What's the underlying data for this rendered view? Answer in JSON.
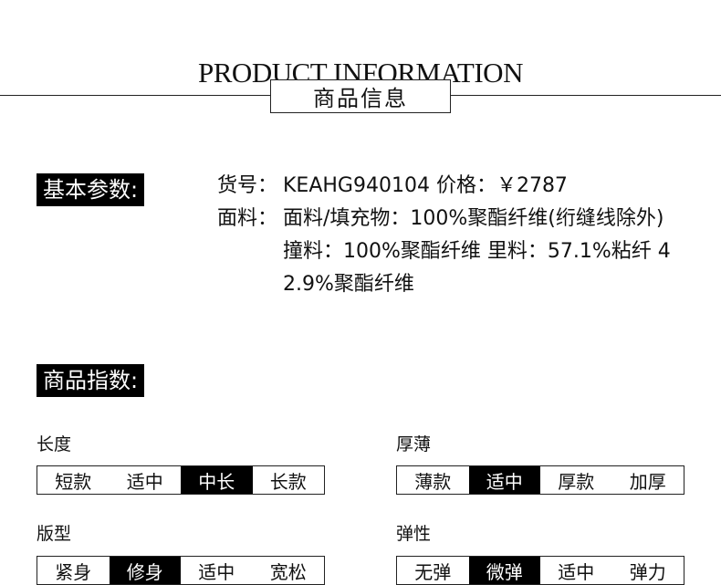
{
  "header": {
    "title_en": "PRODUCT INFORMATION",
    "title_cn": "商品信息"
  },
  "basic": {
    "label": "基本参数:",
    "rows": [
      {
        "key": "货号：",
        "value": "KEAHG940104  价格：￥2787"
      },
      {
        "key": "面料：",
        "value": "面料/填充物：100%聚酯纤维(绗缝线除外) 撞料：100%聚酯纤维 里料：57.1%粘纤 42.9%聚酯纤维"
      }
    ]
  },
  "index": {
    "label": "商品指数:",
    "groups": [
      {
        "title": "长度",
        "options": [
          "短款",
          "适中",
          "中长",
          "长款"
        ],
        "selected": 2
      },
      {
        "title": "厚薄",
        "options": [
          "薄款",
          "适中",
          "厚款",
          "加厚"
        ],
        "selected": 1
      },
      {
        "title": "版型",
        "options": [
          "紧身",
          "修身",
          "适中",
          "宽松"
        ],
        "selected": 1
      },
      {
        "title": "弹性",
        "options": [
          "无弹",
          "微弹",
          "适中",
          "弹力"
        ],
        "selected": 1
      }
    ]
  }
}
